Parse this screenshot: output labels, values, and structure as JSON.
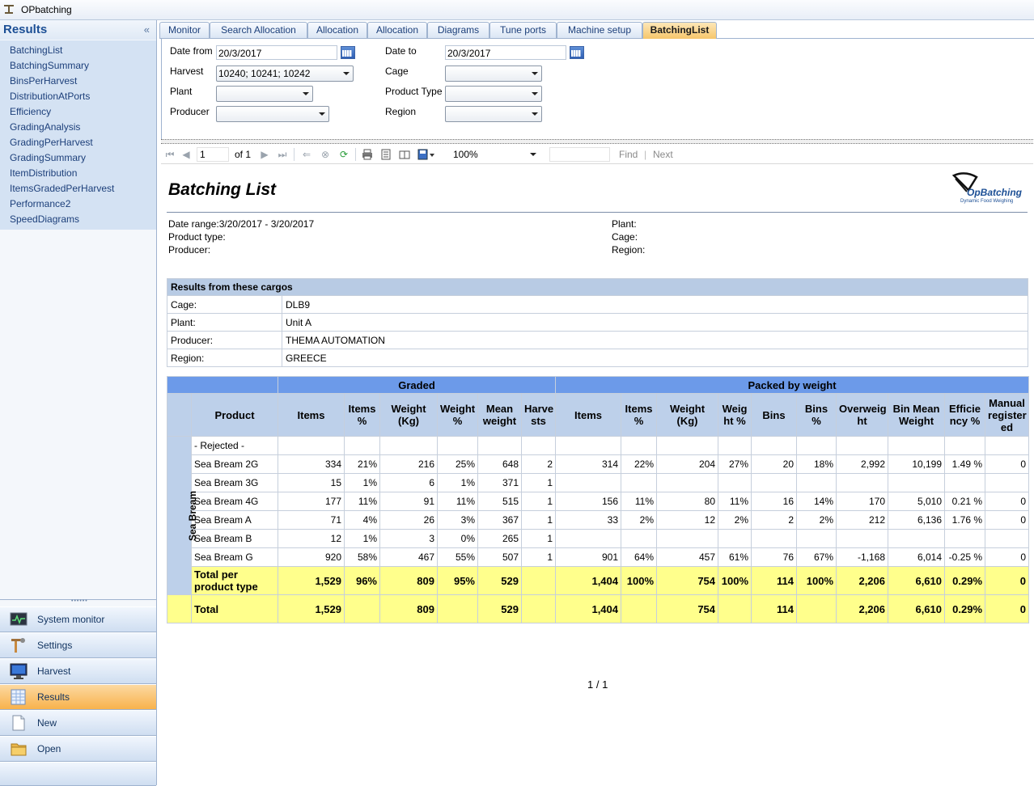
{
  "window": {
    "title": "OPbatching"
  },
  "sidebar": {
    "title": "Results",
    "collapse_glyph": "«",
    "items": [
      "BatchingList",
      "BatchingSummary",
      "BinsPerHarvest",
      "DistributionAtPorts",
      "Efficiency",
      "GradingAnalysis",
      "GradingPerHarvest",
      "GradingSummary",
      "ItemDistribution",
      "ItemsGradedPerHarvest",
      "Performance2",
      "SpeedDiagrams"
    ],
    "nav": [
      {
        "label": "System monitor",
        "icon": "monitor-chart-icon"
      },
      {
        "label": "Settings",
        "icon": "settings-tools-icon"
      },
      {
        "label": "Harvest",
        "icon": "harvest-screen-icon"
      },
      {
        "label": "Results",
        "icon": "results-grid-icon",
        "active": true
      },
      {
        "label": "New",
        "icon": "new-document-icon"
      },
      {
        "label": "Open",
        "icon": "open-folder-icon"
      }
    ]
  },
  "tabs": [
    "Monitor",
    "Search Allocation",
    "Allocation",
    "Allocation",
    "Diagrams",
    "Tune ports",
    "Machine setup",
    "BatchingList"
  ],
  "active_tab": "BatchingList",
  "filter": {
    "date_from_label": "Date from",
    "date_from": "20/3/2017",
    "date_to_label": "Date to",
    "date_to": "20/3/2017",
    "harvest_label": "Harvest",
    "harvest": "10240; 10241; 10242",
    "cage_label": "Cage",
    "cage": "",
    "plant_label": "Plant",
    "plant": "",
    "product_type_label": "Product Type",
    "product_type": "",
    "producer_label": "Producer",
    "producer": "",
    "region_label": "Region",
    "region": ""
  },
  "toolbar": {
    "page": "1",
    "of_label": "of 1",
    "zoom": "100%",
    "search": "",
    "find_label": "Find",
    "separator": "|",
    "next_label": "Next"
  },
  "report": {
    "title": "Batching List",
    "logo_text": "OpBatching",
    "logo_sub": "Dynamic Food Weighing",
    "date_range": "Date range:3/20/2017 - 3/20/2017",
    "product_type": "Product type:",
    "producer": "Producer:",
    "plant": "Plant:",
    "cage": "Cage:",
    "region": "Region:",
    "cargo": {
      "heading": "Results from these cargos",
      "rows": [
        {
          "label": "Cage:",
          "value": "DLB9"
        },
        {
          "label": "Plant:",
          "value": "Unit A"
        },
        {
          "label": "Producer:",
          "value": "THEMA AUTOMATION"
        },
        {
          "label": "Region:",
          "value": "GREECE"
        }
      ]
    },
    "table": {
      "group_graded": "Graded",
      "group_packed": "Packed by weight",
      "side_label": "Sea Bream",
      "headers": [
        "Product",
        "Items",
        "Items %",
        "Weight (Kg)",
        "Weight %",
        "Mean weight",
        "Harvests",
        "Items",
        "Items %",
        "Weight (Kg)",
        "Weight %",
        "Bins",
        "Bins %",
        "Overweight",
        "Bin Mean Weight",
        "Efficiency %",
        "Manual registered"
      ],
      "header_display": [
        "Product",
        "Items",
        "Items %",
        "Weight (Kg)",
        "Weight %",
        "Mean weight",
        "Harve sts",
        "Items",
        "Items %",
        "Weight (Kg)",
        "Weig ht %",
        "Bins",
        "Bins %",
        "Overweig ht",
        "Bin Mean Weight",
        "Efficie ncy %",
        "Manual register ed"
      ],
      "rows": [
        [
          "- Rejected -",
          "",
          "",
          "",
          "",
          "",
          "",
          "",
          "",
          "",
          "",
          "",
          "",
          "",
          "",
          "",
          ""
        ],
        [
          "Sea Bream 2G",
          "334",
          "21%",
          "216",
          "25%",
          "648",
          "2",
          "314",
          "22%",
          "204",
          "27%",
          "20",
          "18%",
          "2,992",
          "10,199",
          "1.49 %",
          "0"
        ],
        [
          "Sea Bream 3G",
          "15",
          "1%",
          "6",
          "1%",
          "371",
          "1",
          "",
          "",
          "",
          "",
          "",
          "",
          "",
          "",
          "",
          ""
        ],
        [
          "Sea Bream 4G",
          "177",
          "11%",
          "91",
          "11%",
          "515",
          "1",
          "156",
          "11%",
          "80",
          "11%",
          "16",
          "14%",
          "170",
          "5,010",
          "0.21 %",
          "0"
        ],
        [
          "Sea Bream A",
          "71",
          "4%",
          "26",
          "3%",
          "367",
          "1",
          "33",
          "2%",
          "12",
          "2%",
          "2",
          "2%",
          "212",
          "6,136",
          "1.76 %",
          "0"
        ],
        [
          "Sea Bream B",
          "12",
          "1%",
          "3",
          "0%",
          "265",
          "1",
          "",
          "",
          "",
          "",
          "",
          "",
          "",
          "",
          "",
          ""
        ],
        [
          "Sea Bream G",
          "920",
          "58%",
          "467",
          "55%",
          "507",
          "1",
          "901",
          "64%",
          "457",
          "61%",
          "76",
          "67%",
          "-1,168",
          "6,014",
          "-0.25 %",
          "0"
        ]
      ],
      "subtotal": [
        "Total per product type",
        "1,529",
        "96%",
        "809",
        "95%",
        "529",
        "",
        "1,404",
        "100%",
        "754",
        "100%",
        "114",
        "100%",
        "2,206",
        "6,610",
        "0.29%",
        "0"
      ],
      "total": [
        "Total",
        "1,529",
        "",
        "809",
        "",
        "529",
        "",
        "1,404",
        "",
        "754",
        "",
        "114",
        "",
        "2,206",
        "6,610",
        "0.29%",
        "0"
      ]
    },
    "pager": "1 / 1"
  },
  "colors": {
    "group_header": "#6c9ae9",
    "column_header": "#bdd0ea",
    "total_row": "#ffff8c",
    "active_nav": "#f8b24c"
  }
}
